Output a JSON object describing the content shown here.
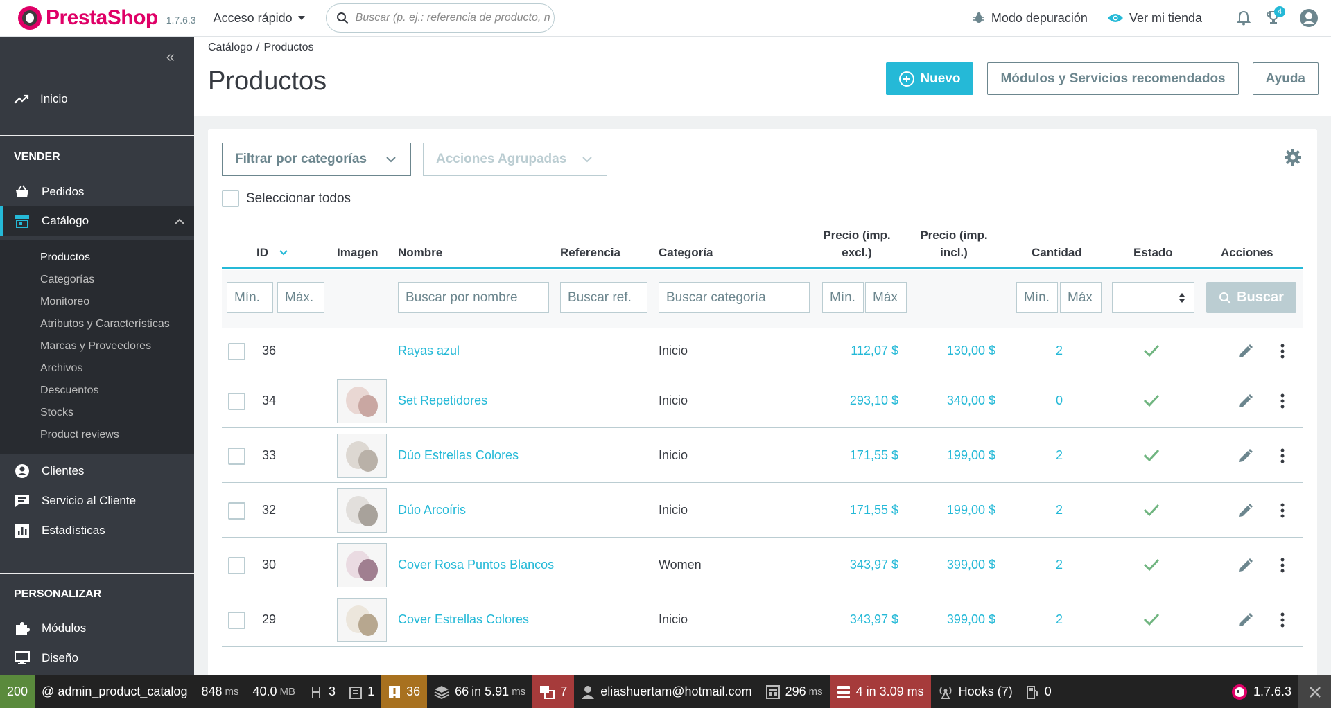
{
  "header": {
    "brand_pre": "Presta",
    "brand_post": "Shop",
    "version": "1.7.6.3",
    "quick_access": "Acceso rápido",
    "search_placeholder": "Buscar (p. ej.: referencia de producto, nombre de cliente…)",
    "debug_mode": "Modo depuración",
    "view_shop": "Ver mi tienda",
    "trophy_badge": "4"
  },
  "sidebar": {
    "home": "Inicio",
    "sell_section": "VENDER",
    "orders": "Pedidos",
    "catalog": "Catálogo",
    "catalog_sub": [
      "Productos",
      "Categorías",
      "Monitoreo",
      "Atributos y Características",
      "Marcas y Proveedores",
      "Archivos",
      "Descuentos",
      "Stocks",
      "Product reviews"
    ],
    "customers": "Clientes",
    "customer_service": "Servicio al Cliente",
    "stats": "Estadísticas",
    "customize_section": "PERSONALIZAR",
    "modules": "Módulos",
    "design": "Diseño"
  },
  "breadcrumb": {
    "parent": "Catálogo",
    "current": "Productos"
  },
  "page_title": "Productos",
  "toolbar": {
    "new": "Nuevo",
    "recommended": "Módulos y Servicios recomendados",
    "help": "Ayuda"
  },
  "filters": {
    "category_filter": "Filtrar por categorías",
    "bulk_actions": "Acciones Agrupadas",
    "select_all": "Seleccionar todos"
  },
  "table": {
    "headers": {
      "id": "ID",
      "image": "Imagen",
      "name": "Nombre",
      "reference": "Referencia",
      "category": "Categoría",
      "price_excl_1": "Precio (imp.",
      "price_excl_2": "excl.)",
      "price_incl_1": "Precio (imp.",
      "price_incl_2": "incl.)",
      "quantity": "Cantidad",
      "status": "Estado",
      "actions": "Acciones"
    },
    "filter_placeholders": {
      "id_min": "Mín.",
      "id_max": "Máx.",
      "name": "Buscar por nombre",
      "reference": "Buscar ref.",
      "category": "Buscar categoría",
      "price_min": "Mín.",
      "price_max": "Máx",
      "qty_min": "Mín.",
      "qty_max": "Máx"
    },
    "search_button": "Buscar",
    "rows": [
      {
        "id": "36",
        "name": "Rayas azul",
        "category": "Inicio",
        "price_excl": "112,07 $",
        "price_incl": "130,00 $",
        "quantity": "2",
        "image": false
      },
      {
        "id": "34",
        "name": "Set Repetidores",
        "category": "Inicio",
        "price_excl": "293,10 $",
        "price_incl": "340,00 $",
        "quantity": "0",
        "image": true
      },
      {
        "id": "33",
        "name": "Dúo Estrellas Colores",
        "category": "Inicio",
        "price_excl": "171,55 $",
        "price_incl": "199,00 $",
        "quantity": "2",
        "image": true
      },
      {
        "id": "32",
        "name": "Dúo Arcoíris",
        "category": "Inicio",
        "price_excl": "171,55 $",
        "price_incl": "199,00 $",
        "quantity": "2",
        "image": true
      },
      {
        "id": "30",
        "name": "Cover Rosa Puntos Blancos",
        "category": "Women",
        "price_excl": "343,97 $",
        "price_incl": "399,00 $",
        "quantity": "2",
        "image": true
      },
      {
        "id": "29",
        "name": "Cover Estrellas Colores",
        "category": "Inicio",
        "price_excl": "343,97 $",
        "price_incl": "399,00 $",
        "quantity": "2",
        "image": true
      }
    ]
  },
  "debugbar": {
    "status": "200",
    "route": "@ admin_product_catalog",
    "time": "848",
    "time_unit": "ms",
    "memory": "40.0",
    "memory_unit": "MB",
    "forms": "3",
    "logs": "1",
    "errors": "36",
    "queries": "66",
    "queries_time": "in 5.91",
    "queries_unit": "ms",
    "translations": "7",
    "user": "eliashuertam@hotmail.com",
    "twig": "296",
    "twig_unit": "ms",
    "cache": "4 in 3.09 ms",
    "hooks": "Hooks (7)",
    "gas": "0",
    "version": "1.7.6.3"
  }
}
